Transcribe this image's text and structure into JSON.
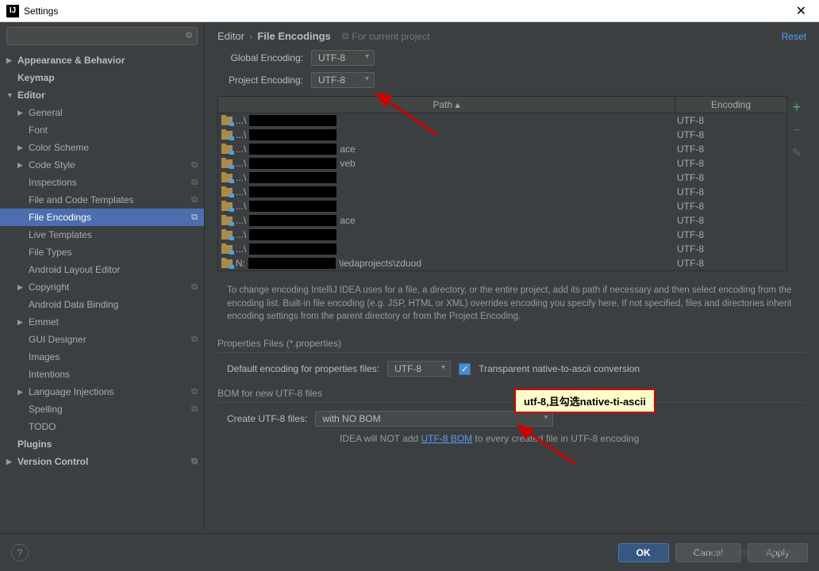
{
  "window": {
    "title": "Settings"
  },
  "sidebar": {
    "search_placeholder": "",
    "items": [
      {
        "label": "Appearance & Behavior",
        "arrow": "▶",
        "bold": true,
        "indent": 0
      },
      {
        "label": "Keymap",
        "arrow": "",
        "bold": true,
        "indent": 0
      },
      {
        "label": "Editor",
        "arrow": "▼",
        "bold": true,
        "indent": 0
      },
      {
        "label": "General",
        "arrow": "▶",
        "bold": false,
        "indent": 1
      },
      {
        "label": "Font",
        "arrow": "",
        "bold": false,
        "indent": 1
      },
      {
        "label": "Color Scheme",
        "arrow": "▶",
        "bold": false,
        "indent": 1
      },
      {
        "label": "Code Style",
        "arrow": "▶",
        "bold": false,
        "indent": 1,
        "badge": "⧉"
      },
      {
        "label": "Inspections",
        "arrow": "",
        "bold": false,
        "indent": 1,
        "badge": "⧉"
      },
      {
        "label": "File and Code Templates",
        "arrow": "",
        "bold": false,
        "indent": 1,
        "badge": "⧉"
      },
      {
        "label": "File Encodings",
        "arrow": "",
        "bold": false,
        "indent": 1,
        "badge": "⧉",
        "selected": true
      },
      {
        "label": "Live Templates",
        "arrow": "",
        "bold": false,
        "indent": 1
      },
      {
        "label": "File Types",
        "arrow": "",
        "bold": false,
        "indent": 1
      },
      {
        "label": "Android Layout Editor",
        "arrow": "",
        "bold": false,
        "indent": 1
      },
      {
        "label": "Copyright",
        "arrow": "▶",
        "bold": false,
        "indent": 1,
        "badge": "⧉"
      },
      {
        "label": "Android Data Binding",
        "arrow": "",
        "bold": false,
        "indent": 1
      },
      {
        "label": "Emmet",
        "arrow": "▶",
        "bold": false,
        "indent": 1
      },
      {
        "label": "GUI Designer",
        "arrow": "",
        "bold": false,
        "indent": 1,
        "badge": "⧉"
      },
      {
        "label": "Images",
        "arrow": "",
        "bold": false,
        "indent": 1
      },
      {
        "label": "Intentions",
        "arrow": "",
        "bold": false,
        "indent": 1
      },
      {
        "label": "Language Injections",
        "arrow": "▶",
        "bold": false,
        "indent": 1,
        "badge": "⧉"
      },
      {
        "label": "Spelling",
        "arrow": "",
        "bold": false,
        "indent": 1,
        "badge": "⧉"
      },
      {
        "label": "TODO",
        "arrow": "",
        "bold": false,
        "indent": 1
      },
      {
        "label": "Plugins",
        "arrow": "",
        "bold": true,
        "indent": 0
      },
      {
        "label": "Version Control",
        "arrow": "▶",
        "bold": true,
        "indent": 0,
        "badge": "⧉"
      }
    ]
  },
  "breadcrumb": {
    "parent": "Editor",
    "current": "File Encodings",
    "for_project": "For current project"
  },
  "reset_label": "Reset",
  "global_encoding": {
    "label": "Global Encoding:",
    "value": "UTF-8"
  },
  "project_encoding": {
    "label": "Project Encoding:",
    "value": "UTF-8"
  },
  "table": {
    "col_path": "Path ▴",
    "col_encoding": "Encoding",
    "rows": [
      {
        "prefix": "...\\",
        "blackw": 110,
        "suffix": "",
        "encoding": "UTF-8"
      },
      {
        "prefix": "...\\",
        "blackw": 110,
        "suffix": "",
        "encoding": "UTF-8"
      },
      {
        "prefix": "...\\",
        "blackw": 110,
        "suffix": "ace",
        "encoding": "UTF-8"
      },
      {
        "prefix": "...\\",
        "blackw": 110,
        "suffix": "veb",
        "encoding": "UTF-8"
      },
      {
        "prefix": "...\\",
        "blackw": 110,
        "suffix": "",
        "encoding": "UTF-8"
      },
      {
        "prefix": "...\\",
        "blackw": 110,
        "suffix": "",
        "encoding": "UTF-8"
      },
      {
        "prefix": "...\\",
        "blackw": 110,
        "suffix": "",
        "encoding": "UTF-8"
      },
      {
        "prefix": "...\\",
        "blackw": 110,
        "suffix": "ace",
        "encoding": "UTF-8"
      },
      {
        "prefix": "...\\",
        "blackw": 110,
        "suffix": "",
        "encoding": "UTF-8"
      },
      {
        "prefix": "...\\",
        "blackw": 110,
        "suffix": "",
        "encoding": "UTF-8"
      },
      {
        "prefix": "N:",
        "blackw": 110,
        "suffix": "\\iedaprojects\\zduod",
        "encoding": "UTF-8"
      }
    ]
  },
  "help_text": "To change encoding IntelliJ IDEA uses for a file, a directory, or the entire project, add its path if necessary and then select encoding from the encoding list. Built-in file encoding (e.g. JSP, HTML or XML) overrides encoding you specify here. If not specified, files and directories inherit encoding settings from the parent directory or from the Project Encoding.",
  "properties": {
    "header": "Properties Files (*.properties)",
    "default_label": "Default encoding for properties files:",
    "default_value": "UTF-8",
    "transparent_label": "Transparent native-to-ascii conversion"
  },
  "bom": {
    "header": "BOM for new UTF-8 files",
    "create_label": "Create UTF-8 files:",
    "create_value": "with NO BOM",
    "footer_prefix": "IDEA will NOT add ",
    "footer_link": "UTF-8 BOM",
    "footer_suffix": " to every created file in UTF-8 encoding"
  },
  "buttons": {
    "ok": "OK",
    "cancel": "Cancel",
    "apply": "Apply"
  },
  "annotation": "utf-8,且勾选native-ti-ascii",
  "watermark": "https://blog.csdn.net/ninahao"
}
